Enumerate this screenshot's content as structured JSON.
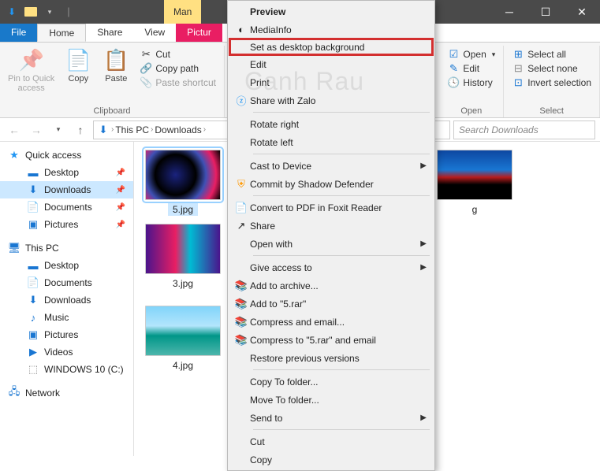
{
  "titlebar": {
    "manage": "Man"
  },
  "tabs": {
    "file": "File",
    "home": "Home",
    "share": "Share",
    "view": "View",
    "picture": "Pictur"
  },
  "ribbon": {
    "pin": "Pin to Quick\naccess",
    "copy": "Copy",
    "paste": "Paste",
    "cut": "Cut",
    "copypath": "Copy path",
    "pasteshortcut": "Paste shortcut",
    "clipboard": "Clipboard",
    "open_group": "Open",
    "open": "Open",
    "edit": "Edit",
    "history": "History",
    "select_group": "Select",
    "selectall": "Select all",
    "selectnone": "Select none",
    "invert": "Invert selection"
  },
  "breadcrumb": {
    "thispc": "This PC",
    "downloads": "Downloads"
  },
  "search": {
    "placeholder": "Search Downloads"
  },
  "sidebar": {
    "quick": "Quick access",
    "desktop": "Desktop",
    "downloads": "Downloads",
    "documents": "Documents",
    "pictures": "Pictures",
    "thispc": "This PC",
    "desktop2": "Desktop",
    "documents2": "Documents",
    "downloads2": "Downloads",
    "music": "Music",
    "pictures2": "Pictures",
    "videos": "Videos",
    "drive": "WINDOWS 10 (C:)",
    "network": "Network"
  },
  "files": {
    "f1": "5.jpg",
    "f2": "g",
    "f3": "3.jpg",
    "f4": "4.jpg"
  },
  "ctx": {
    "preview": "Preview",
    "mediainfo": "MediaInfo",
    "setdesktop": "Set as desktop background",
    "edit": "Edit",
    "print": "Print",
    "zalo": "Share with Zalo",
    "rotright": "Rotate right",
    "rotleft": "Rotate left",
    "cast": "Cast to Device",
    "commit": "Commit by Shadow Defender",
    "convertpdf": "Convert to PDF in Foxit Reader",
    "share": "Share",
    "openwith": "Open with",
    "giveaccess": "Give access to",
    "addarchive": "Add to archive...",
    "addto5rar": "Add to \"5.rar\"",
    "compressemail": "Compress and email...",
    "compress5rar": "Compress to \"5.rar\" and email",
    "restore": "Restore previous versions",
    "copyto": "Copy To folder...",
    "moveto": "Move To folder...",
    "sendto": "Send to",
    "cut": "Cut",
    "copy": "Copy"
  },
  "watermark": "Canh Rau"
}
